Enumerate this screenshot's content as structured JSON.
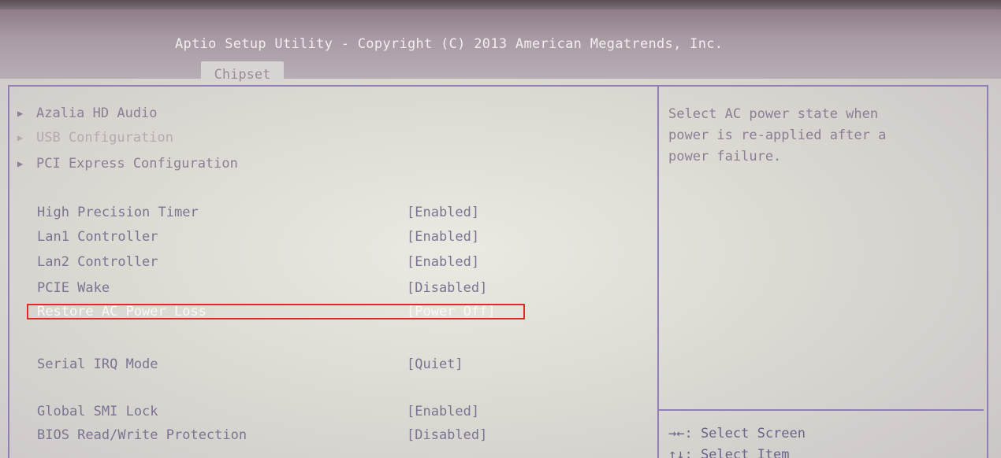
{
  "header": {
    "title": "Aptio Setup Utility - Copyright (C) 2013 American Megatrends, Inc.",
    "active_tab": "Chipset"
  },
  "submenus": [
    {
      "label": "Azalia HD Audio"
    },
    {
      "label": "USB Configuration"
    },
    {
      "label": "PCI Express Configuration"
    }
  ],
  "settings": [
    {
      "label": "High Precision Timer",
      "value": "[Enabled]"
    },
    {
      "label": "Lan1 Controller",
      "value": "[Enabled]"
    },
    {
      "label": "Lan2 Controller",
      "value": "[Enabled]"
    },
    {
      "label": "PCIE Wake",
      "value": "[Disabled]"
    },
    {
      "label": "Restore AC Power Loss",
      "value": "[Power Off]"
    },
    {
      "label": "Serial IRQ Mode",
      "value": "[Quiet]"
    },
    {
      "label": "Global SMI Lock",
      "value": "[Enabled]"
    },
    {
      "label": "BIOS Read/Write Protection",
      "value": "[Disabled]"
    }
  ],
  "help": {
    "lines": [
      "Select AC power state when",
      "power is re-applied after a",
      "power failure."
    ]
  },
  "key_help": [
    {
      "text": "→←: Select Screen"
    },
    {
      "text": "↑↓: Select Item"
    }
  ],
  "colors": {
    "frame": "#8e80b6",
    "highlight": "#e02a2a",
    "header_bg": "#a89aa4"
  }
}
